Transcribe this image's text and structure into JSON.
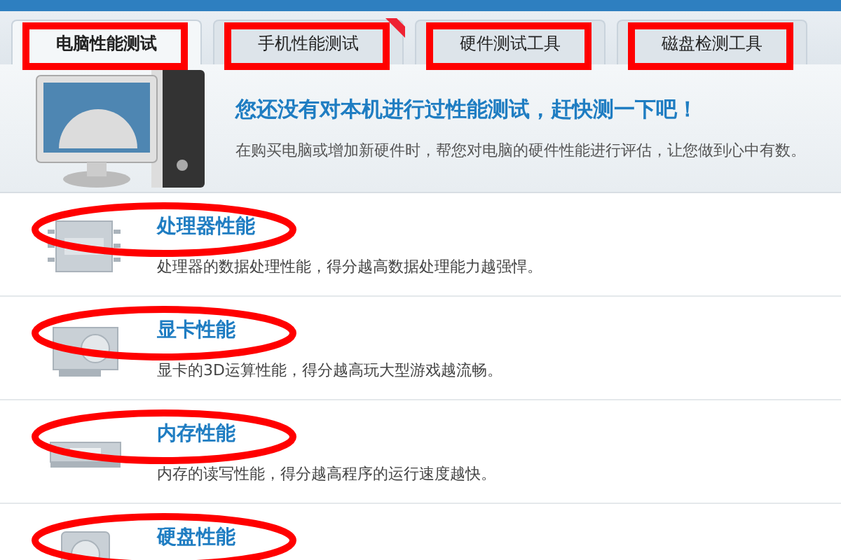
{
  "tabs": [
    {
      "label": "电脑性能测试",
      "selected": true,
      "highlighted": true,
      "new": false
    },
    {
      "label": "手机性能测试",
      "selected": false,
      "highlighted": true,
      "new": true
    },
    {
      "label": "硬件测试工具",
      "selected": false,
      "highlighted": true,
      "new": false
    },
    {
      "label": "磁盘检测工具",
      "selected": false,
      "highlighted": true,
      "new": false
    }
  ],
  "hero": {
    "headline": "您还没有对本机进行过性能测试，赶快测一下吧！",
    "subtitle": "在购买电脑或增加新硬件时，帮您对电脑的硬件性能进行评估，让您做到心中有数。"
  },
  "features": [
    {
      "kind": "cpu",
      "title": "处理器性能",
      "description": "处理器的数据处理性能，得分越高数据处理能力越强悍。",
      "highlighted": true
    },
    {
      "kind": "gpu",
      "title": "显卡性能",
      "description": "显卡的3D运算性能，得分越高玩大型游戏越流畅。",
      "highlighted": true
    },
    {
      "kind": "ram",
      "title": "内存性能",
      "description": "内存的读写性能，得分越高程序的运行速度越快。",
      "highlighted": true
    },
    {
      "kind": "disk",
      "title": "硬盘性能",
      "highlighted": true
    }
  ]
}
